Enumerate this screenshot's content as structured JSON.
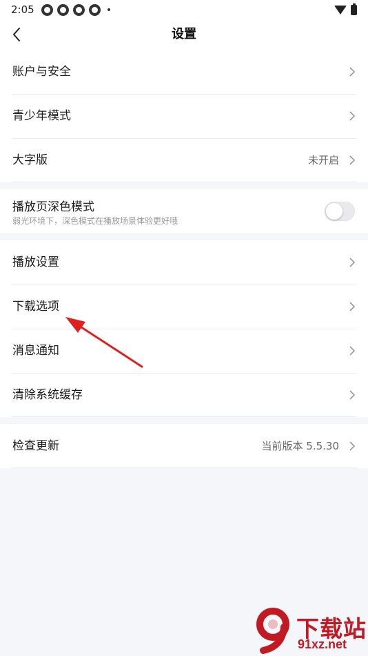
{
  "status_bar": {
    "time": "2:05"
  },
  "header": {
    "title": "设置"
  },
  "groups": [
    {
      "rows": [
        {
          "label": "账户与安全",
          "value": ""
        },
        {
          "label": "青少年模式",
          "value": ""
        },
        {
          "label": "大字版",
          "value": "未开启"
        }
      ]
    },
    {
      "toggle": {
        "title": "播放页深色模式",
        "subtitle": "弱光环境下，深色模式在播放场景体验更好哦",
        "enabled": false
      }
    },
    {
      "rows": [
        {
          "label": "播放设置",
          "value": ""
        },
        {
          "label": "下载选项",
          "value": ""
        },
        {
          "label": "消息通知",
          "value": ""
        },
        {
          "label": "清除系统缓存",
          "value": ""
        }
      ]
    },
    {
      "rows": [
        {
          "label": "检查更新",
          "value": "当前版本 5.5.30"
        }
      ]
    }
  ],
  "annotation": {
    "arrow_color": "#e02020",
    "target": "下载选项"
  },
  "watermark": {
    "text": "下载站",
    "url": "91xz.net",
    "color": "#c21a22"
  },
  "colors": {
    "background": "#f5f6fa",
    "card": "#ffffff",
    "chevron": "#999999"
  }
}
